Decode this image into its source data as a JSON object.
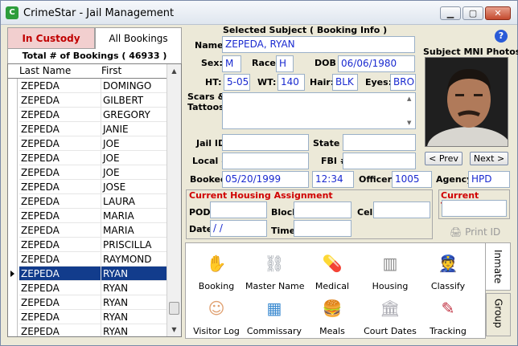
{
  "window": {
    "title": "CrimeStar - Jail Management",
    "minimize": "▁",
    "maximize": "▢",
    "close": "✕"
  },
  "tabs": {
    "in_custody": "In Custody",
    "all_bookings": "All Bookings"
  },
  "total": "Total # of Bookings ( 46933 )",
  "grid": {
    "col_last": "Last Name",
    "col_first": "First",
    "rows": [
      {
        "last": "ZEPEDA",
        "first": "DOMINGO"
      },
      {
        "last": "ZEPEDA",
        "first": "GILBERT"
      },
      {
        "last": "ZEPEDA",
        "first": "GREGORY"
      },
      {
        "last": "ZEPEDA",
        "first": "JANIE"
      },
      {
        "last": "ZEPEDA",
        "first": "JOE"
      },
      {
        "last": "ZEPEDA",
        "first": "JOE"
      },
      {
        "last": "ZEPEDA",
        "first": "JOE"
      },
      {
        "last": "ZEPEDA",
        "first": "JOSE"
      },
      {
        "last": "ZEPEDA",
        "first": "LAURA"
      },
      {
        "last": "ZEPEDA",
        "first": "MARIA"
      },
      {
        "last": "ZEPEDA",
        "first": "MARIA"
      },
      {
        "last": "ZEPEDA",
        "first": "PRISCILLA"
      },
      {
        "last": "ZEPEDA",
        "first": "RAYMOND"
      },
      {
        "last": "ZEPEDA",
        "first": "RYAN"
      },
      {
        "last": "ZEPEDA",
        "first": "RYAN"
      },
      {
        "last": "ZEPEDA",
        "first": "RYAN"
      },
      {
        "last": "ZEPEDA",
        "first": "RYAN"
      },
      {
        "last": "ZEPEDA",
        "first": "RYAN"
      }
    ],
    "selected_index": 13
  },
  "subject": {
    "heading": "Selected Subject ( Booking Info )",
    "name_label": "Name:",
    "name": "ZEPEDA, RYAN",
    "sex_label": "Sex:",
    "sex": "M",
    "race_label": "Race:",
    "race": "H",
    "dob_label": "DOB :",
    "dob": "06/06/1980",
    "ht_label": "HT:",
    "ht": "5-05",
    "wt_label": "WT:",
    "wt": "140",
    "hair_label": "Hair:",
    "hair": "BLK",
    "eyes_label": "Eyes:",
    "eyes": "BRO",
    "scars_label": "Scars &\nTattoos",
    "scars": "",
    "jail_id_label": "Jail ID",
    "jail_id": "",
    "state_label": "State #",
    "state": "",
    "local_label": "Local #",
    "local": "",
    "fbi_label": "FBI #",
    "fbi": "",
    "booked_label": "Booked:",
    "booked_date": "05/20/1999",
    "booked_time": "12:34",
    "officer_label": "Officer:",
    "officer": "1005",
    "agency_label": "Agency:",
    "agency": "HPD"
  },
  "photos": {
    "heading": "Subject MNI Photos",
    "prev": "< Prev",
    "next": "Next >"
  },
  "housing": {
    "heading": "Current Housing Assignment",
    "pod_label": "POD",
    "pod": "",
    "block_label": "Block",
    "block": "",
    "cell_label": "Cell",
    "cell": "",
    "date_label": "Date",
    "date": " / /",
    "time_label": "Time",
    "time": ""
  },
  "tracking": {
    "heading": "Current Tracking",
    "value": ""
  },
  "print_id": "Print ID",
  "help": "?",
  "side_tabs": {
    "inmate": "Inmate",
    "group": "Group"
  },
  "modules": [
    {
      "label": "Booking",
      "icon": "booking-icon",
      "glyph": "✋",
      "color": "#c89a78"
    },
    {
      "label": "Master Name",
      "icon": "handcuffs-icon",
      "glyph": "⛓",
      "color": "#9aa0a8"
    },
    {
      "label": "Medical",
      "icon": "pill-icon",
      "glyph": "💊",
      "color": "#e05a6a"
    },
    {
      "label": "Housing",
      "icon": "cell-door-icon",
      "glyph": "▥",
      "color": "#8a8a8a"
    },
    {
      "label": "Classify",
      "icon": "officer-icon",
      "glyph": "👮",
      "color": "#7a7a7a"
    },
    {
      "label": "Visitor Log",
      "icon": "visitor-icon",
      "glyph": "☺",
      "color": "#e0a070"
    },
    {
      "label": "Commissary",
      "icon": "calculator-icon",
      "glyph": "▦",
      "color": "#3a8ad0"
    },
    {
      "label": "Meals",
      "icon": "burger-icon",
      "glyph": "🍔",
      "color": "#c08040"
    },
    {
      "label": "Court Dates",
      "icon": "courthouse-icon",
      "glyph": "🏛",
      "color": "#a8a8b0"
    },
    {
      "label": "Tracking",
      "icon": "scanner-icon",
      "glyph": "✎",
      "color": "#c03040"
    }
  ]
}
